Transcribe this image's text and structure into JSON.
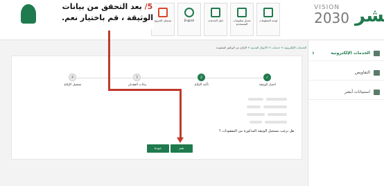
{
  "instruction": {
    "step_num": "5/",
    "line1": "بعد التحقق من بيانات",
    "line2": "الوثيقة ، قم باختيار نعم."
  },
  "header": {
    "vision_word": "VISION",
    "vision_year": "2030",
    "absher_logo": "أبشر",
    "tiles": [
      {
        "label": "لوحة المعلومات"
      },
      {
        "label": "تعديل معلومات المستخدم"
      },
      {
        "label": "دليل الخدمات"
      },
      {
        "label": "English"
      },
      {
        "label": "تسجيل الخروج"
      }
    ]
  },
  "breadcrumb": {
    "c1": "الخدمات الإلكترونية",
    "c2": "خدمات",
    "c3": "الأحوال المدنية",
    "c4": "الإبلاغ عن الوثائق المفقودة"
  },
  "sidebar": [
    {
      "label": "الخدمات الإلكترونية"
    },
    {
      "label": "التفاويض"
    },
    {
      "label": "استبيانات أبشر"
    }
  ],
  "steps": [
    {
      "num": "1",
      "label": "اختيار الوثيقة"
    },
    {
      "num": "2",
      "label": "تأكيد الإبلاغ"
    },
    {
      "num": "3",
      "label": "بيانات الفقدان"
    },
    {
      "num": "4",
      "label": "تسجيل الإبلاغ"
    }
  ],
  "question": "هل ترغب بتسجيل الوثيقة المذكورة من المفقودات ؟",
  "buttons": {
    "yes": "نعم",
    "back": "عودة"
  },
  "colors": {
    "accent": "#1f7a4d",
    "arrow": "#c0392b"
  }
}
